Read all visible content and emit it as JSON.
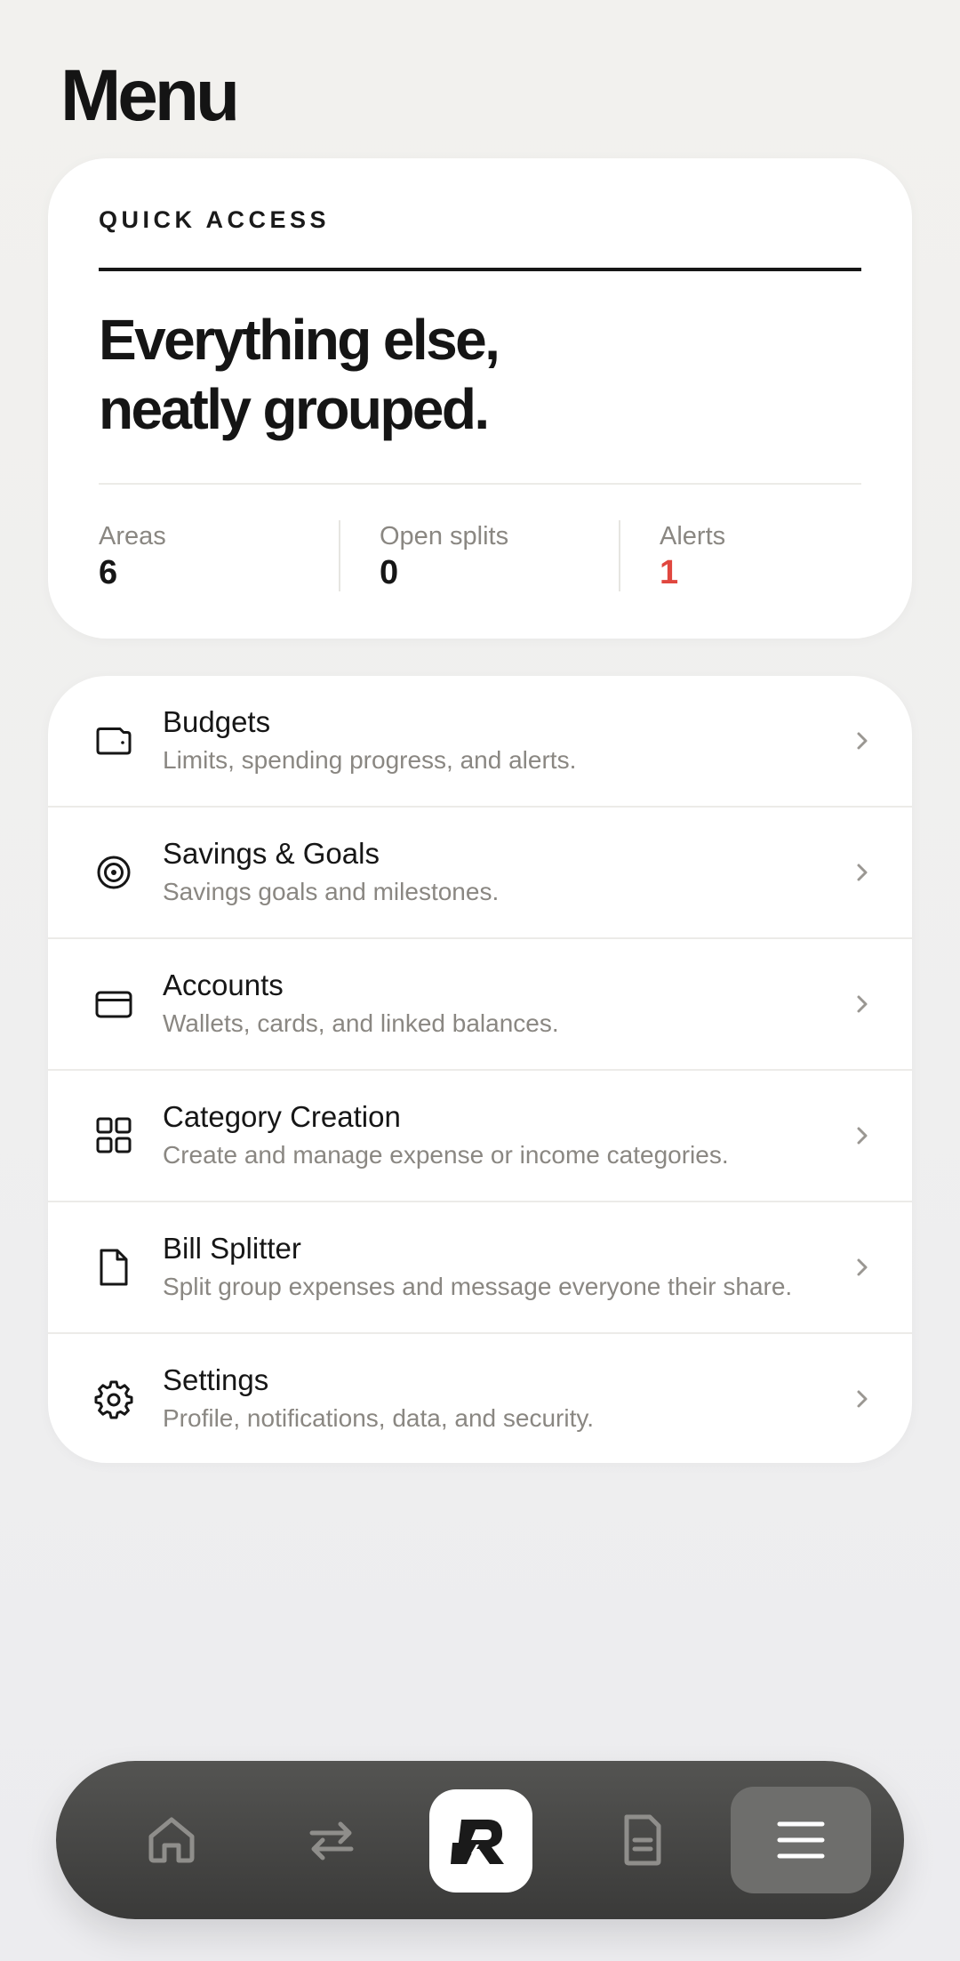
{
  "page": {
    "title": "Menu"
  },
  "quick_access": {
    "label": "QUICK ACCESS",
    "headline_line1": "Everything else,",
    "headline_line2": "neatly grouped.",
    "stats": [
      {
        "label": "Areas",
        "value": "6"
      },
      {
        "label": "Open splits",
        "value": "0"
      },
      {
        "label": "Alerts",
        "value": "1"
      }
    ]
  },
  "menu_items": [
    {
      "title": "Budgets",
      "subtitle": "Limits, spending progress, and alerts.",
      "icon": "wallet-icon"
    },
    {
      "title": "Savings & Goals",
      "subtitle": "Savings goals and milestones.",
      "icon": "target-icon"
    },
    {
      "title": "Accounts",
      "subtitle": "Wallets, cards, and linked balances.",
      "icon": "card-icon"
    },
    {
      "title": "Category Creation",
      "subtitle": "Create and manage expense or income categories.",
      "icon": "grid-icon"
    },
    {
      "title": "Bill Splitter",
      "subtitle": "Split group expenses and message everyone their share.",
      "icon": "document-icon"
    },
    {
      "title": "Settings",
      "subtitle": "Profile, notifications, data, and security.",
      "icon": "gear-icon"
    }
  ],
  "bottom_nav": [
    {
      "icon": "home-icon",
      "active": false
    },
    {
      "icon": "swap-arrows-icon",
      "active": false
    },
    {
      "icon": "app-logo-icon",
      "active": false
    },
    {
      "icon": "receipt-icon",
      "active": false
    },
    {
      "icon": "menu-icon",
      "active": true
    }
  ],
  "colors": {
    "background": "#f0efec",
    "card": "#ffffff",
    "text": "#161616",
    "muted": "#8a8782",
    "alert": "#e0473f",
    "nav": "#454544",
    "nav_active": "#6e6e6c"
  }
}
